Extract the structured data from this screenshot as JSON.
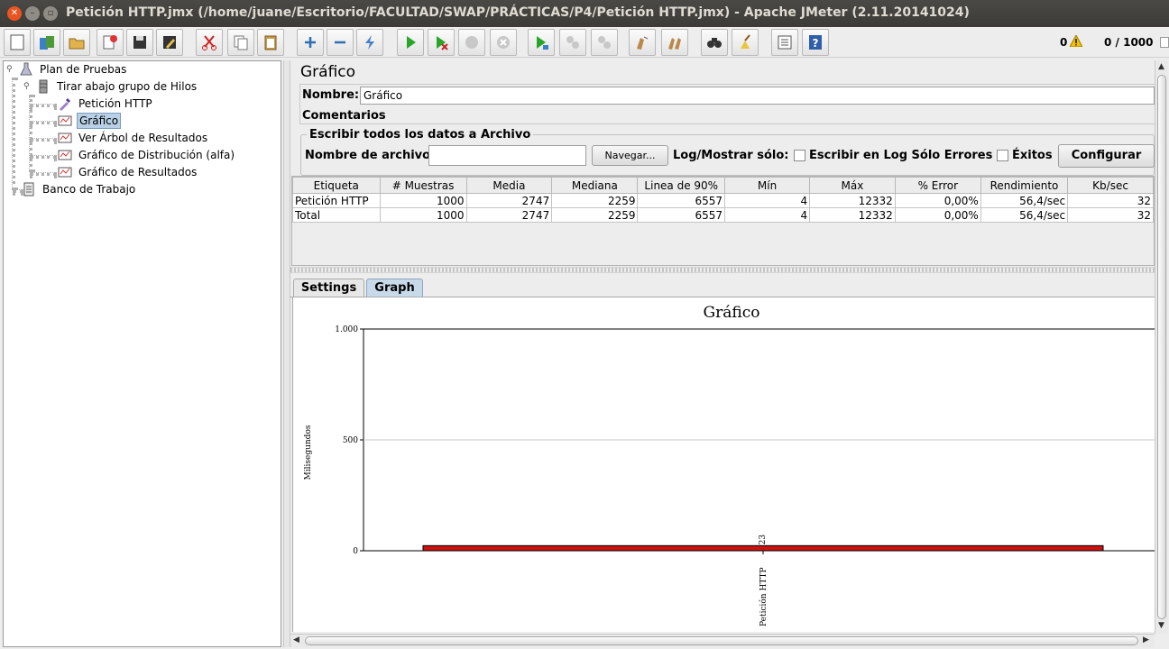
{
  "window": {
    "title": "Petición HTTP.jmx (/home/juane/Escritorio/FACULTAD/SWAP/PRÁCTICAS/P4/Petición HTTP.jmx) - Apache JMeter (2.11.20141024)"
  },
  "toolbar": {
    "icons": [
      "new-icon",
      "templates-icon",
      "open-icon",
      "close-file-icon",
      "save-icon",
      "save-as-icon",
      "cut-icon",
      "copy-icon",
      "paste-icon",
      "expand-icon",
      "collapse-icon",
      "toggle-icon",
      "start-icon",
      "start-no-pause-icon",
      "stop-icon",
      "shutdown-icon",
      "remote-start-icon",
      "remote-stop-icon",
      "remote-shutdown-icon",
      "clear-icon",
      "clear-all-icon",
      "search-icon",
      "reset-search-icon",
      "function-helper-icon",
      "help-icon"
    ],
    "error_count": "0",
    "thread_count": "0 / 1000"
  },
  "tree": {
    "items": [
      {
        "label": "Plan de Pruebas"
      },
      {
        "label": "Tirar abajo grupo de Hilos"
      },
      {
        "label": "Petición HTTP"
      },
      {
        "label": "Gráfico"
      },
      {
        "label": "Ver Árbol de Resultados"
      },
      {
        "label": "Gráfico de Distribución (alfa)"
      },
      {
        "label": "Gráfico de Resultados"
      },
      {
        "label": "Banco de Trabajo"
      }
    ]
  },
  "panel": {
    "title": "Gráfico",
    "name_label": "Nombre:",
    "name_value": "Gráfico",
    "comments_label": "Comentarios",
    "file_section": "Escribir todos los datos a Archivo",
    "file_label": "Nombre de archivo",
    "browse_label": "Navegar...",
    "log_label": "Log/Mostrar sólo:",
    "errors_only_label": "Escribir en Log Sólo Errores",
    "success_label": "Éxitos",
    "configure_label": "Configurar"
  },
  "table": {
    "headers": [
      "Etiqueta",
      "# Muestras",
      "Media",
      "Mediana",
      "Linea de 90%",
      "Mín",
      "Máx",
      "% Error",
      "Rendimiento",
      "Kb/sec"
    ],
    "rows": [
      [
        "Petición HTTP",
        "1000",
        "2747",
        "2259",
        "6557",
        "4",
        "12332",
        "0,00%",
        "56,4/sec",
        "32"
      ],
      [
        "Total",
        "1000",
        "2747",
        "2259",
        "6557",
        "4",
        "12332",
        "0,00%",
        "56,4/sec",
        "32"
      ]
    ]
  },
  "tabs": {
    "settings": "Settings",
    "graph": "Graph"
  },
  "chart_data": {
    "type": "bar",
    "title": "Gráfico",
    "ylabel": "Milisegundos",
    "xlabel": "",
    "ylim": [
      0,
      1000
    ],
    "yticks": [
      "0",
      "500",
      "1.000"
    ],
    "categories": [
      "Petición HTTP"
    ],
    "values": [
      23
    ],
    "value_labels": [
      "23"
    ],
    "bar_color": "#cc1111",
    "grid": true
  }
}
